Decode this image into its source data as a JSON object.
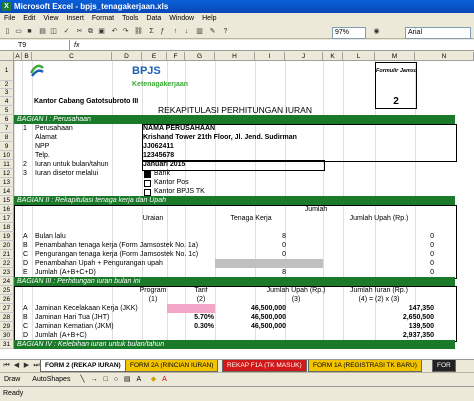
{
  "window": {
    "title": "Microsoft Excel - bpjs_tenagakerjaan.xls"
  },
  "menu": [
    "File",
    "Edit",
    "View",
    "Insert",
    "Format",
    "Tools",
    "Data",
    "Window",
    "Help"
  ],
  "toolbar": {
    "zoom": "97%",
    "font": "Arial"
  },
  "formula_bar": {
    "name_box": "T9",
    "fx": "fx"
  },
  "columns": [
    "A",
    "B",
    "C",
    "D",
    "E",
    "F",
    "G",
    "H",
    "I",
    "J",
    "K",
    "L",
    "M",
    "N"
  ],
  "rows": [
    "1",
    "2",
    "3",
    "4",
    "5",
    "6",
    "7",
    "8",
    "9",
    "10",
    "11",
    "12",
    "13",
    "14",
    "15",
    "16",
    "17",
    "18",
    "19",
    "20",
    "21",
    "22",
    "23",
    "24",
    "25",
    "26",
    "27",
    "28",
    "29",
    "30",
    "31"
  ],
  "sheet": {
    "logo_text": "BPJS",
    "logo_sub": "Ketenagakerjaan",
    "branch": "Kantor Cabang Gatotsubroto III",
    "form_label": "Formulir Jamsostek",
    "form_number": "2",
    "main_title": "REKAPITULASI PERHITUNGAN IURAN",
    "section1": "BAGIAN I : Perusahaan",
    "r7_no": "1",
    "r7_label": "Perusahaan",
    "r7_value": "NAMA PERUSAHAAN",
    "r8_label": "Alamat",
    "r8_value": "Krishand Tower 21th Floor, Jl. Jend. Sudirman",
    "r9_label": "NPP",
    "r9_value": "JJ062411",
    "r10_label": "Telp.",
    "r10_value": "12345678",
    "r11_no": "2",
    "r11_label": "Iuran untuk bulan/tahun",
    "r11_value": "Januari 2015",
    "r12_no": "3",
    "r12_label": "Iuran disetor melalui",
    "r12_opt": "Bank",
    "r13_opt": "Kantor Pos",
    "r14_opt": "Kantor BPJS TK",
    "section2": "BAGIAN II : Rekapitulasi tenaga kerja dan Upah",
    "jumlah": "Jumlah",
    "uraian": "Uraian",
    "tenaga_kerja": "Tenaga Kerja",
    "jumlah_upah": "Jumlah Upah (Rp.)",
    "r19_code": "A",
    "r19_label": "Bulan lalu",
    "r19_tk": "8",
    "r19_upah": "0",
    "r20_code": "B",
    "r20_label": "Penambahan tenaga kerja (Form Jamsostek No. 1a)",
    "r20_tk": "0",
    "r20_upah": "0",
    "r21_code": "C",
    "r21_label": "Pengurangan tenaga kerja (Form Jamsostek No. 1c)",
    "r21_tk": "0",
    "r21_upah": "0",
    "r22_code": "D",
    "r22_label": "Penambahan Upah + Pengurangan upah",
    "r22_upah": "0",
    "r23_code": "E",
    "r23_label": "Jumlah (A+B+C+D)",
    "r23_tk": "8",
    "r23_upah": "0",
    "section3": "BAGIAN III : Perhitungan iuran bulan ini",
    "program": "Program",
    "tarif": "Tarif",
    "jumlah_upah2": "Jumlah Upah (Rp.)",
    "jumlah_iuran": "Jumlah Iuran (Rp.)",
    "c1": "(1)",
    "c2": "(2)",
    "c3": "(3)",
    "c4": "(4) = (2) x (3)",
    "r27_code": "A",
    "r27_label": "Jaminan Kecelakaan Kerja (JKK)",
    "r27_upah": "46,500,000",
    "r27_iuran": "147,350",
    "r28_code": "B",
    "r28_label": "Jaminan Hari Tua (JHT)",
    "r28_tarif": "5.70%",
    "r28_upah": "46,500,000",
    "r28_iuran": "2,650,500",
    "r29_code": "C",
    "r29_label": "Jaminan Kematian (JKM)",
    "r29_tarif": "0.30%",
    "r29_upah": "46,500,000",
    "r29_iuran": "139,500",
    "r30_code": "D",
    "r30_label": "Jumlah (A+B+C)",
    "r30_iuran": "2,937,350",
    "section4": "BAGIAN IV : Kelebihan iuran untuk bulan/tahun"
  },
  "sheet_tabs": [
    "FORM 2 (REKAP IURAN)",
    "FORM 2A (RINCIAN IURAN)",
    "REKAP F1A (TK MASUK)",
    "FORM 1A (REGISTRASI TK BARU)",
    "FOR"
  ],
  "drawing": {
    "draw": "Draw",
    "autoshapes": "AutoShapes"
  },
  "status": "Ready",
  "colors": {
    "titlebar": "#0a5fd8",
    "section_bar": "#1a7a2a",
    "logo_blue": "#1a5fb4",
    "logo_green": "#3aaa35"
  }
}
